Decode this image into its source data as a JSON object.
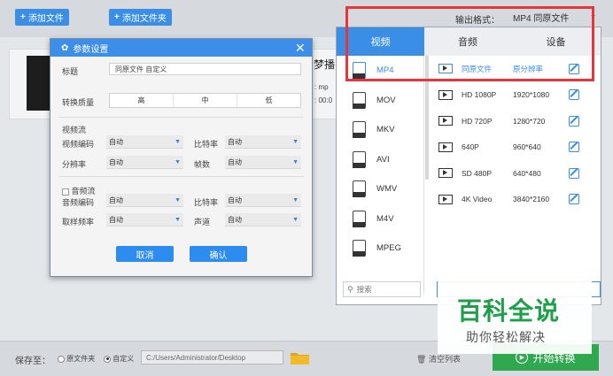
{
  "toolbar": {
    "add_file": "添加文件",
    "add_folder": "添加文件夹",
    "output_format_label": "输出格式：",
    "output_format_value": "MP4  同原文件"
  },
  "background": {
    "filename_partial": "梦播",
    "meta1": ": mp",
    "meta2": ": 00:0"
  },
  "dialog": {
    "title": "参数设置",
    "title_label": "标题",
    "title_value": "同原文件 自定义",
    "quality_label": "转换质量",
    "quality_options": [
      "高",
      "中",
      "低"
    ],
    "video_stream": "视频流",
    "video_codec_label": "视频编码",
    "video_codec_value": "自动",
    "bitrate_label": "比特率",
    "bitrate_value": "自动",
    "resolution_label": "分辨率",
    "resolution_value": "自动",
    "framerate_label": "帧数",
    "framerate_value": "自动",
    "audio_stream": "音频流",
    "audio_codec_label": "音频编码",
    "audio_codec_value": "自动",
    "audio_bitrate_label": "比特率",
    "audio_bitrate_value": "自动",
    "samplerate_label": "取样频率",
    "samplerate_value": "自动",
    "channel_label": "声道",
    "channel_value": "自动",
    "cancel": "取消",
    "confirm": "确认"
  },
  "format_panel": {
    "tabs": [
      "视频",
      "音频",
      "设备"
    ],
    "formats": [
      "MP4",
      "MOV",
      "MKV",
      "AVI",
      "WMV",
      "M4V",
      "MPEG"
    ],
    "search_placeholder": "搜索",
    "resolutions": [
      {
        "name": "同原文件",
        "dim": "原分辨率"
      },
      {
        "name": "HD 1080P",
        "dim": "1920*1080"
      },
      {
        "name": "HD 720P",
        "dim": "1280*720"
      },
      {
        "name": "640P",
        "dim": "960*640"
      },
      {
        "name": "SD 480P",
        "dim": "640*480"
      },
      {
        "name": "4K Video",
        "dim": "3840*2160"
      }
    ]
  },
  "bottom": {
    "save_to": "保存至：",
    "option_source": "原文件夹",
    "option_custom": "自定义",
    "path": "C:/Users/Administrator/Desktop",
    "clear_list": "清空列表",
    "start": "开始转换"
  },
  "watermark": {
    "brand": "百科全说",
    "sub": "助你轻松解决"
  },
  "colors": {
    "accent": "#3a8ee6",
    "highlight_box": "#e8343a",
    "start_button": "#2fa84f"
  }
}
